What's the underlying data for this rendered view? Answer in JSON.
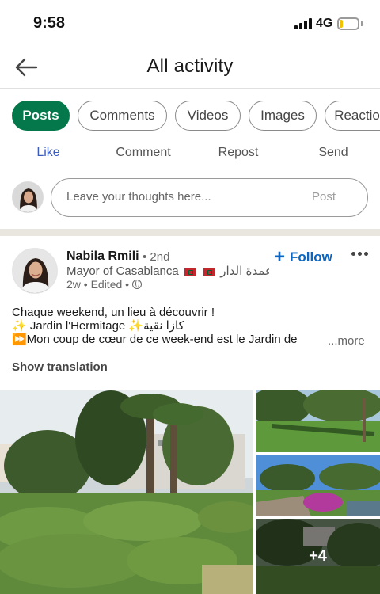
{
  "status_bar": {
    "time": "9:58",
    "network": "4G",
    "battery_level": 0.2,
    "battery_color": "#f2c200"
  },
  "header": {
    "back_icon": "arrow-left-icon",
    "title": "All activity"
  },
  "tabs": [
    {
      "label": "Posts",
      "active": true
    },
    {
      "label": "Comments",
      "active": false
    },
    {
      "label": "Videos",
      "active": false
    },
    {
      "label": "Images",
      "active": false
    },
    {
      "label": "Reactions",
      "active": false
    }
  ],
  "actions": {
    "like": "Like",
    "comment": "Comment",
    "repost": "Repost",
    "send": "Send"
  },
  "composer": {
    "placeholder": "Leave your thoughts here...",
    "post_label": "Post"
  },
  "post": {
    "author_name": "Nabila Rmili",
    "degree": "• 2nd",
    "headline_prefix": "Mayor of Casablanca",
    "headline_suffix": "عمدة الدار...",
    "time": "2w • Edited •",
    "follow_label": "Follow",
    "text_lines": [
      "Chaque weekend, un lieu à découvrir !",
      "✨ Jardin l'Hermitage ✨كازا نقية",
      "⏩Mon coup de cœur de ce week-end est le Jardin de"
    ],
    "see_more": "...more",
    "show_translation": "Show translation",
    "more_photos": "+4"
  },
  "colors": {
    "accent_green": "#04784a",
    "follow_blue": "#0a66c2",
    "like_blue": "#3a5bbf"
  }
}
